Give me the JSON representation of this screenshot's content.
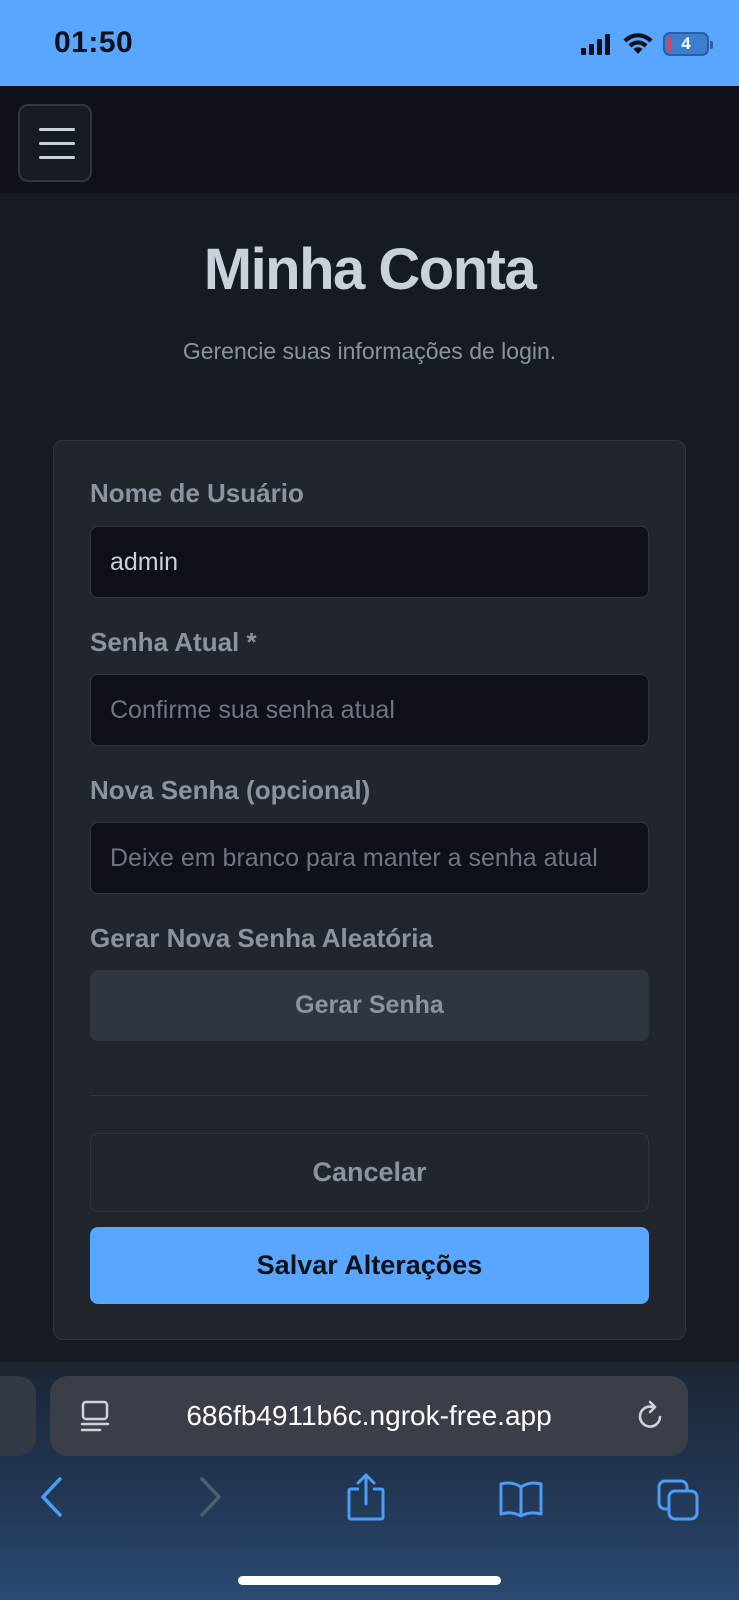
{
  "status_bar": {
    "time": "01:50",
    "battery": "4"
  },
  "header": {
    "menu_icon": "hamburger-icon"
  },
  "page": {
    "title": "Minha Conta",
    "subtitle": "Gerencie suas informações de login."
  },
  "form": {
    "username_label": "Nome de Usuário",
    "username_value": "admin",
    "current_password_label": "Senha Atual *",
    "current_password_placeholder": "Confirme sua senha atual",
    "new_password_label": "Nova Senha (opcional)",
    "new_password_placeholder": "Deixe em branco para manter a senha atual",
    "generate_label": "Gerar Nova Senha Aleatória",
    "generate_button": "Gerar Senha",
    "cancel_button": "Cancelar",
    "save_button": "Salvar Alterações"
  },
  "browser": {
    "url": "686fb4911b6c.ngrok-free.app",
    "icons": [
      "page-menu-icon",
      "reload-icon",
      "back-icon",
      "forward-icon",
      "share-icon",
      "bookmarks-icon",
      "tabs-icon"
    ]
  },
  "colors": {
    "accent": "#58a6ff",
    "background": "#161b22",
    "card": "#21262d",
    "input_background": "#0d1117"
  }
}
